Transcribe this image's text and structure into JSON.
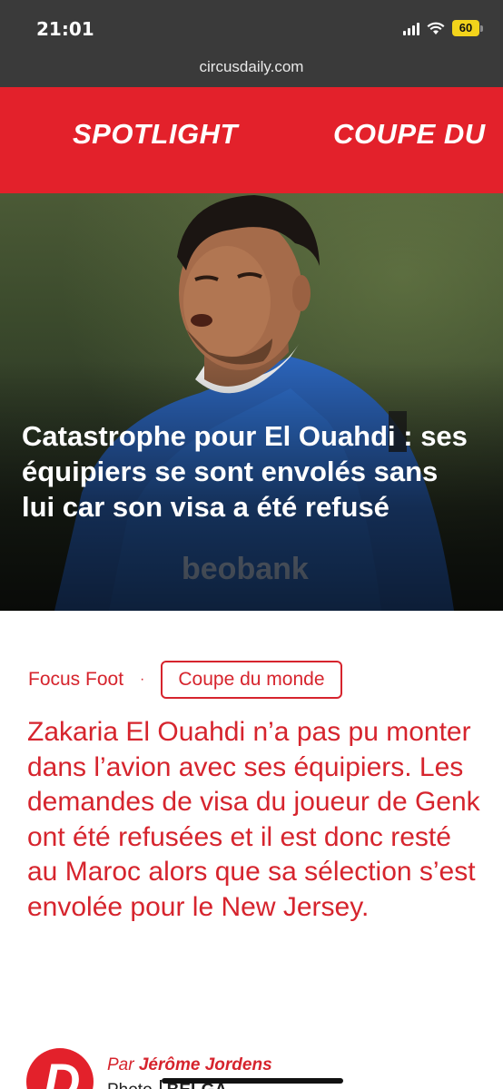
{
  "status_bar": {
    "time": "21:01",
    "battery": "60",
    "icons": [
      "signal-icon",
      "wifi-icon",
      "battery-icon"
    ]
  },
  "browser": {
    "url": "circusdaily.com"
  },
  "nav": {
    "items": [
      {
        "label": "SPOTLIGHT"
      },
      {
        "label": "COUPE DU"
      }
    ]
  },
  "hero": {
    "title": "Catastrophe pour El Ouahdi : ses équipiers se sont envolés sans lui car son visa a été refusé",
    "image": "player-photo"
  },
  "article": {
    "category": "Focus Foot",
    "separator": "·",
    "tag": "Coupe du monde",
    "lead": "Zakaria El Ouahdi n’a pas pu monter dans l’avion avec ses équipiers. Les demandes de visa du joueur de Genk ont été refusées et il est donc resté au Maroc alors que sa sélection s’est envolée pour le New Jersey.",
    "author_prefix": "Par",
    "author": "Jérôme Jordens",
    "photo_prefix": "Photo",
    "photo_credit": "BELGA"
  },
  "colors": {
    "brand_red": "#e3212b",
    "text_red": "#d6242d",
    "chrome": "#3a3a3a"
  }
}
